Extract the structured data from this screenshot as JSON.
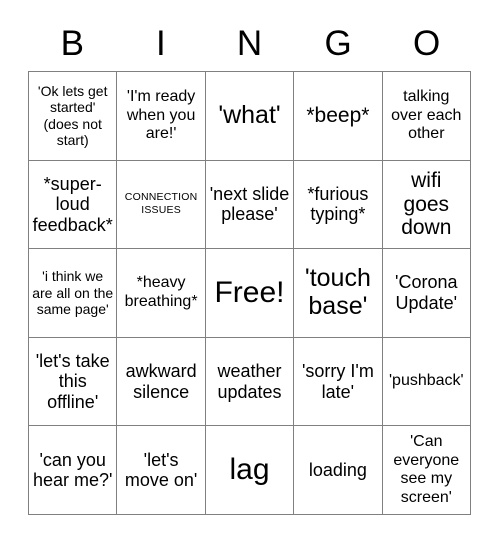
{
  "card": {
    "title_letters": [
      "B",
      "I",
      "N",
      "G",
      "O"
    ],
    "grid_size": 5,
    "free_space_index": 12,
    "colors": {
      "background": "#ffffff",
      "text": "#000000",
      "border": "#808080"
    }
  },
  "cells": [
    {
      "text": "'Ok lets get started' (does not start)",
      "size": "xs"
    },
    {
      "text": "'I'm ready when you are!'",
      "size": "sm"
    },
    {
      "text": "'what'",
      "size": "xl"
    },
    {
      "text": "*beep*",
      "size": "lg"
    },
    {
      "text": "talking over each other",
      "size": "sm"
    },
    {
      "text": "*super-loud feedback*",
      "size": "md"
    },
    {
      "text": "CONNECTION ISSUES",
      "size": "xxs"
    },
    {
      "text": "'next slide please'",
      "size": "md"
    },
    {
      "text": "*furious typing*",
      "size": "md"
    },
    {
      "text": "wifi goes down",
      "size": "lg"
    },
    {
      "text": "'i think we are all on the same page'",
      "size": "xs"
    },
    {
      "text": "*heavy breathing*",
      "size": "sm"
    },
    {
      "text": "Free!",
      "size": "xxl"
    },
    {
      "text": "'touch base'",
      "size": "xl"
    },
    {
      "text": "'Corona Update'",
      "size": "md"
    },
    {
      "text": "'let's take this offline'",
      "size": "md"
    },
    {
      "text": "awkward silence",
      "size": "md"
    },
    {
      "text": "weather updates",
      "size": "md"
    },
    {
      "text": "'sorry I'm late'",
      "size": "md"
    },
    {
      "text": "'pushback'",
      "size": "sm"
    },
    {
      "text": "'can you hear me?'",
      "size": "md"
    },
    {
      "text": "'let's move on'",
      "size": "md"
    },
    {
      "text": "lag",
      "size": "xxl"
    },
    {
      "text": "loading",
      "size": "md"
    },
    {
      "text": "'Can everyone see my screen'",
      "size": "sm"
    }
  ]
}
